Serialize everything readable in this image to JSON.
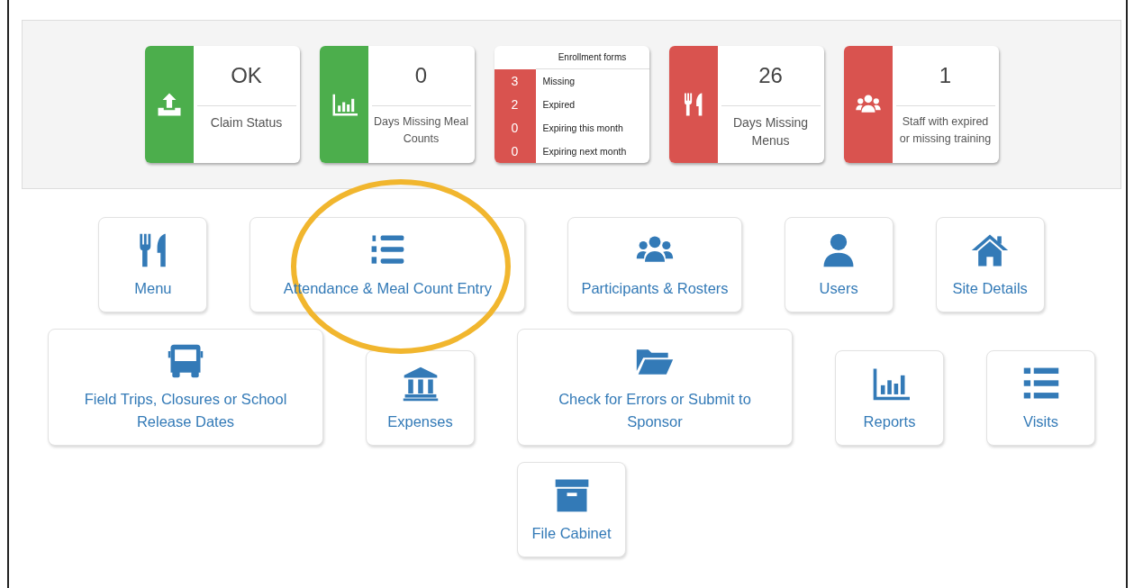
{
  "status_cards": [
    {
      "kind": "stat",
      "color": "#4cae4c",
      "value": "OK",
      "label": "Claim Status"
    },
    {
      "kind": "stat",
      "color": "#4cae4c",
      "value": "0",
      "label": "Days Missing Meal Counts"
    },
    {
      "kind": "list",
      "color": "#d9534f",
      "title": "Enrollment forms",
      "rows": [
        {
          "count": "3",
          "label": "Missing"
        },
        {
          "count": "2",
          "label": "Expired"
        },
        {
          "count": "0",
          "label": "Expiring this month"
        },
        {
          "count": "0",
          "label": "Expiring next month"
        }
      ]
    },
    {
      "kind": "stat",
      "color": "#d9534f",
      "value": "26",
      "label": "Days Missing Menus"
    },
    {
      "kind": "stat",
      "color": "#d9534f",
      "value": "1",
      "label": "Staff with expired or missing training"
    }
  ],
  "tile_rows": [
    [
      {
        "label": "Menu",
        "kind": "narrow"
      },
      {
        "label": "Attendance & Meal Count Entry",
        "kind": "wide"
      },
      {
        "label": "Participants & Rosters",
        "kind": "auto"
      },
      {
        "label": "Users",
        "kind": "narrow"
      },
      {
        "label": "Site Details",
        "kind": "narrow"
      }
    ],
    [
      {
        "label": "Field Trips, Closures or School Release Dates",
        "kind": "wide"
      },
      {
        "label": "Expenses",
        "kind": "narrow"
      },
      {
        "label": "Check for Errors or Submit to Sponsor",
        "kind": "wide"
      },
      {
        "label": "Reports",
        "kind": "narrow"
      },
      {
        "label": "Visits",
        "kind": "narrow"
      }
    ],
    [
      {
        "label": "File Cabinet",
        "kind": "narrow"
      }
    ]
  ]
}
